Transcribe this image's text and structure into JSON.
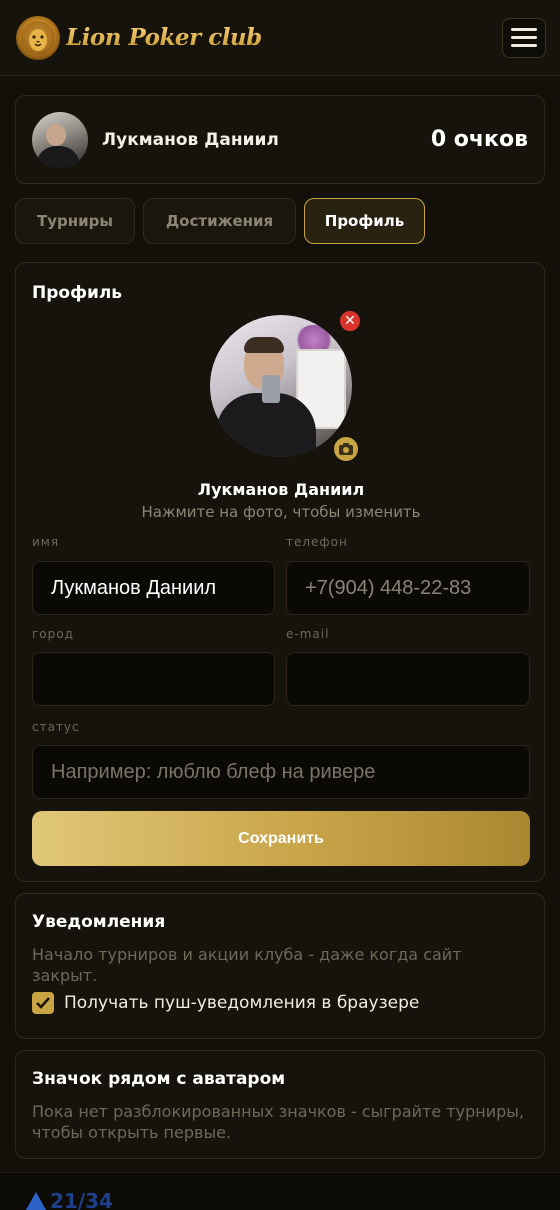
{
  "header": {
    "brand": "Lion Poker club",
    "menu_icon": "hamburger-menu-icon",
    "logo_icon": "lion-logo-icon"
  },
  "user": {
    "name": "Лукманов Даниил",
    "points": "0 очков"
  },
  "tabs": [
    {
      "label": "Турниры",
      "active": false
    },
    {
      "label": "Достижения",
      "active": false
    },
    {
      "label": "Профиль",
      "active": true
    }
  ],
  "profile": {
    "title": "Профиль",
    "name": "Лукманов Даниил",
    "hint": "Нажмите на фото, чтобы изменить",
    "remove_icon": "close-icon",
    "camera_icon": "camera-icon",
    "fields": {
      "name_label": "имя",
      "name_value": "Лукманов Даниил",
      "phone_label": "телефон",
      "phone_value": "+7(904) 448-22-83",
      "city_label": "город",
      "city_value": "",
      "email_label": "e-mail",
      "email_value": "",
      "status_label": "статус",
      "status_placeholder": "Например: люблю блеф на ривере"
    },
    "save_label": "Сохранить"
  },
  "notifications": {
    "title": "Уведомления",
    "text": "Начало турниров и акции клуба - даже когда сайт закрыт.",
    "checkbox_label": "Получать пуш-уведомления в браузере",
    "checked": true
  },
  "badge": {
    "title": "Значок рядом с аватаром",
    "text": "Пока нет разблокированных значков - сыграйте турниры, чтобы открыть первые."
  },
  "footer": {
    "logo_text": "21/34"
  },
  "colors": {
    "background": "#121008",
    "card": "#16130c",
    "accent_gold": "#c9a444",
    "remove_red": "#d9342b"
  }
}
